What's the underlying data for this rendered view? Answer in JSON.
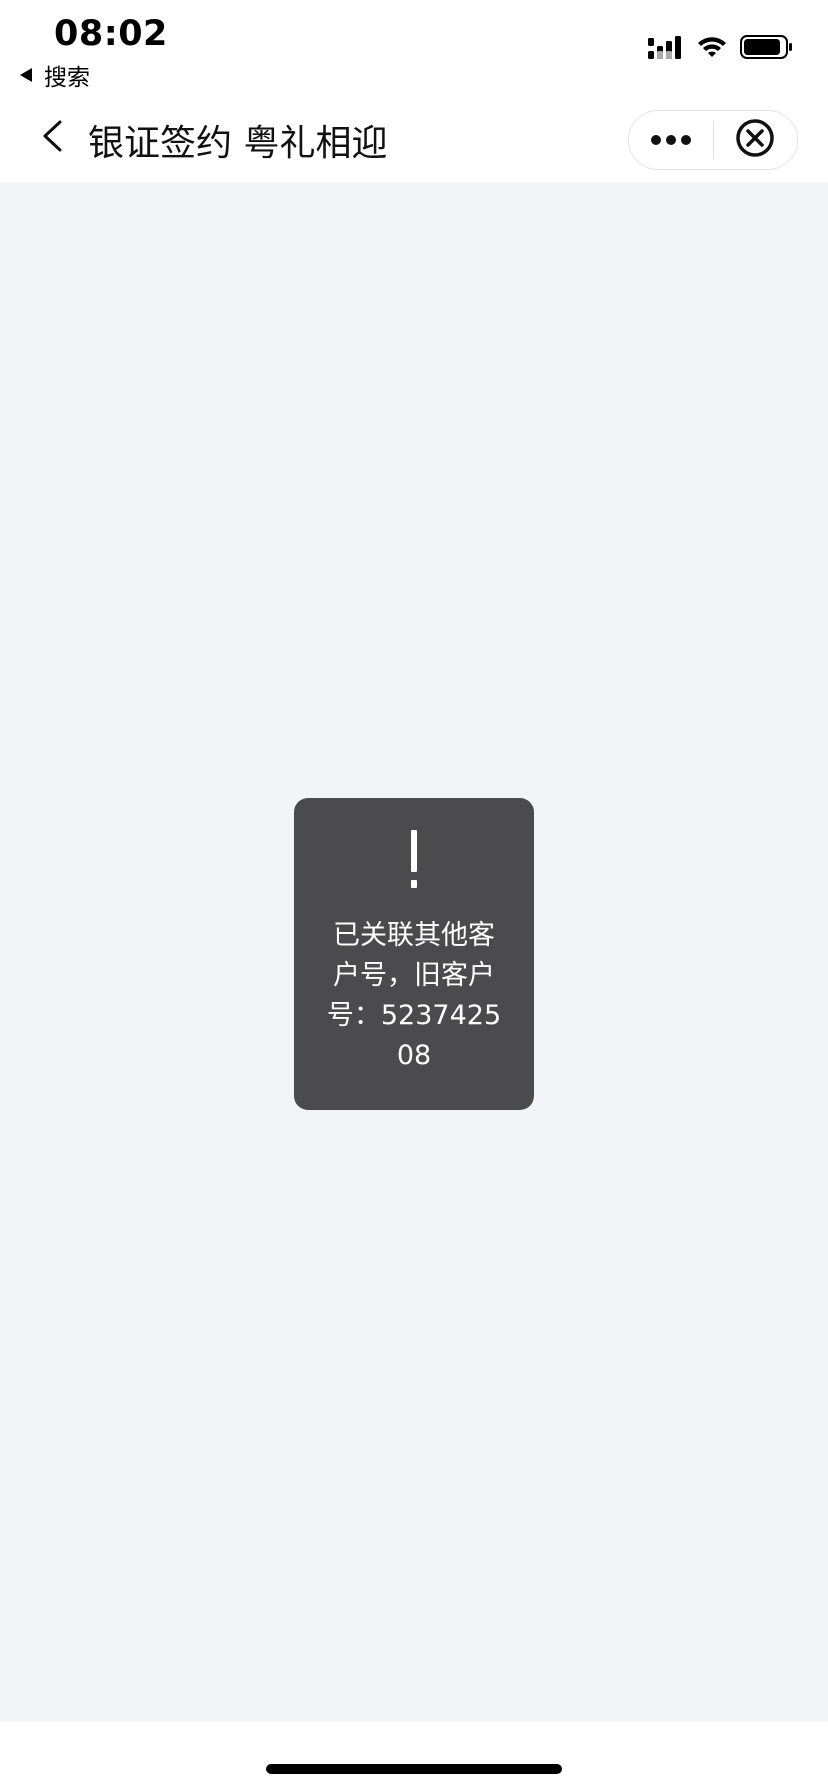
{
  "status_bar": {
    "time": "08:02",
    "back_app_label": "搜索",
    "icons": [
      "signal-icon",
      "wifi-icon",
      "battery-icon"
    ]
  },
  "nav": {
    "title": "银证签约 粤礼相迎",
    "back_icon": "chevron-left-icon",
    "more_icon": "more-dots-icon",
    "close_icon": "close-circle-icon"
  },
  "toast": {
    "icon": "exclamation-icon",
    "message": "已关联其他客户号，旧客户号：523742508"
  },
  "colors": {
    "background": "#f3f4f8",
    "toast_bg": "#4b4b4e",
    "text_primary": "#111111"
  }
}
